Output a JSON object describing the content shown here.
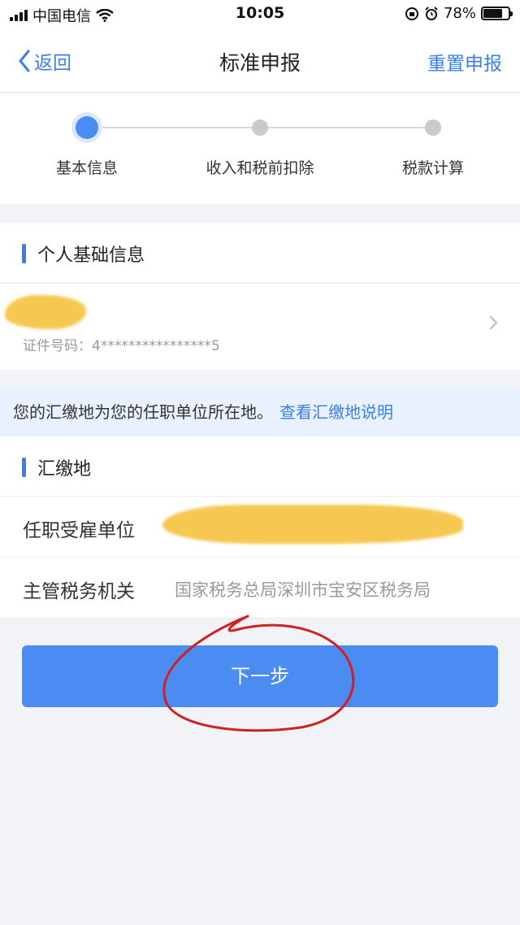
{
  "status_bar": {
    "carrier": "中国电信",
    "time": "10:05",
    "battery": "78%",
    "battery_level": 0.78
  },
  "nav": {
    "back_label": "返回",
    "title": "标准申报",
    "reset_label": "重置申报"
  },
  "steps": [
    {
      "label": "基本信息",
      "state": "active"
    },
    {
      "label": "收入和税前扣除",
      "state": "pending"
    },
    {
      "label": "税款计算",
      "state": "pending"
    }
  ],
  "personal_section": {
    "title": "个人基础信息",
    "id_label": "证件号码：",
    "id_value": "4****************5"
  },
  "notice": {
    "text": "您的汇缴地为您的任职单位所在地。",
    "link": "查看汇缴地说明"
  },
  "payment_section": {
    "title": "汇缴地",
    "employer_label": "任职受雇单位",
    "authority_label": "主管税务机关",
    "authority_value": "国家税务总局深圳市宝安区税务局"
  },
  "next_button": "下一步",
  "colors": {
    "accent": "#3a7ee8",
    "button": "#4a8cf2",
    "notice_bg": "#e8f1fd",
    "redaction": "#f6c13a",
    "annotation": "#d21f1f"
  },
  "icons": [
    "signal-bars-icon",
    "wifi-icon",
    "orientation-lock-icon",
    "alarm-icon",
    "battery-icon",
    "chevron-left-icon",
    "chevron-right-icon"
  ]
}
